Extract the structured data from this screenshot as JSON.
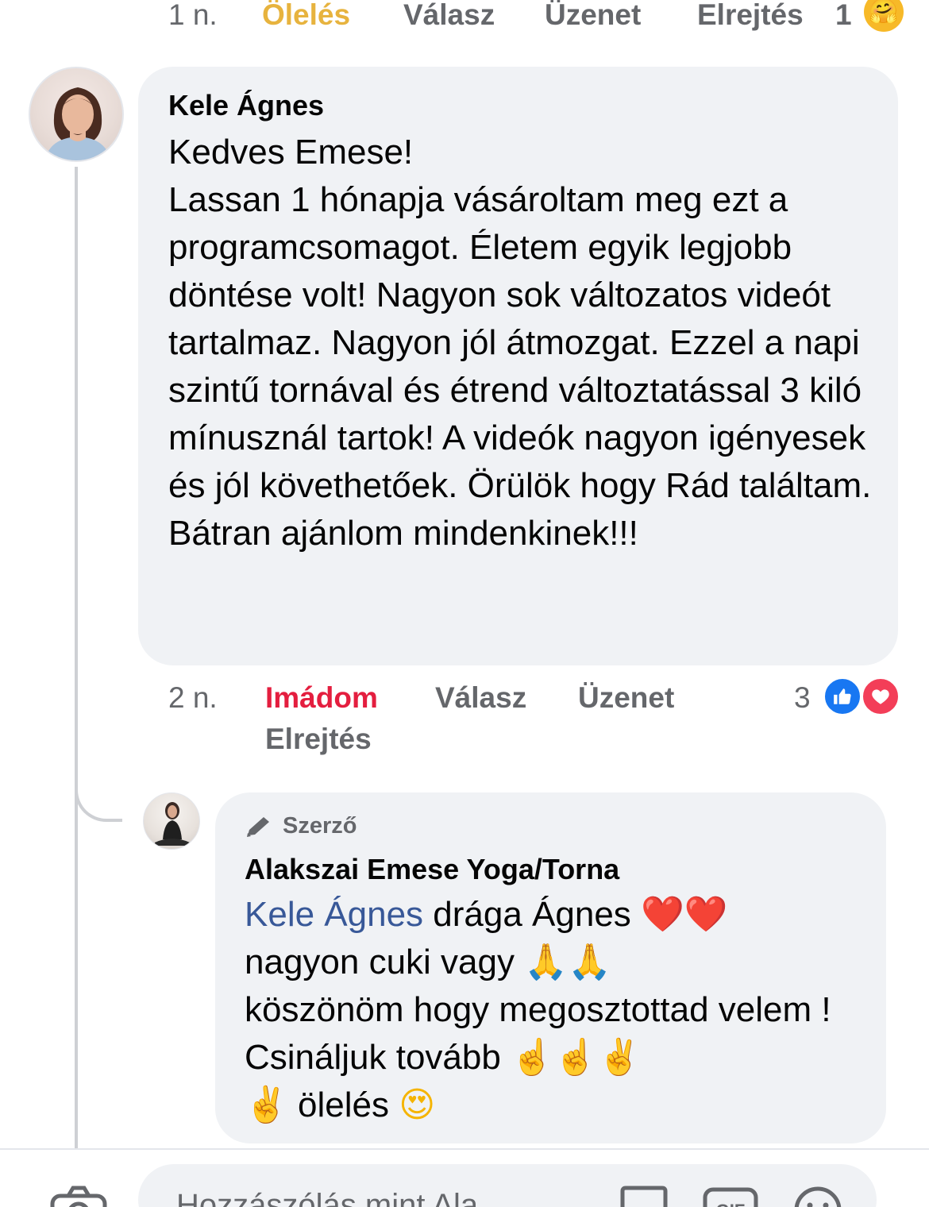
{
  "previous_comment_actions": {
    "time": "1 n.",
    "reaction_label": "Ölelés",
    "reply": "Válasz",
    "message": "Üzenet",
    "hide": "Elrejtés",
    "reaction_count": "1",
    "reaction_icon": "care-emoji-icon"
  },
  "comment": {
    "author": "Kele Ágnes",
    "text": "Kedves Emese!\nLassan 1 hónapja vásároltam meg ezt a programcsomagot. Életem egyik legjobb döntése volt! Nagyon sok változatos videót tartalmaz. Nagyon jól átmozgat. Ezzel a napi szintű tornával és étrend változtatással 3 kiló mínusznál tartok! A videók nagyon igényesek és jól követhetőek. Örülök hogy Rád találtam. Bátran ajánlom mindenkinek!!!",
    "actions": {
      "time": "2 n.",
      "reaction_label": "Imádom",
      "reply": "Válasz",
      "message": "Üzenet",
      "hide": "Elrejtés",
      "reaction_count": "3"
    }
  },
  "reply": {
    "badge": "Szerző",
    "author": "Alakszai Emese Yoga/Torna",
    "mention": "Kele Ágnes",
    "text_part1": " drága Ágnes ",
    "emoji_hearts": "❤️❤️",
    "text_part2": "nagyon cuki vagy ",
    "emoji_pray": "🙏🙏",
    "text_part3": "köszönöm hogy megosztottad velem ! Csináljuk tovább ",
    "emoji_hands": "☝️☝️✌️",
    "emoji_victory": "✌️",
    "text_part4": " ölelés ",
    "emoji_love_eyes": "😍"
  },
  "composer": {
    "placeholder": "Hozzászólás mint Ala..."
  },
  "colors": {
    "bubble": "#f0f2f5",
    "secondary_text": "#65676b",
    "love": "#e41e3f",
    "care": "#e7b33e",
    "mention": "#385898",
    "like_blue": "#1877f2"
  }
}
